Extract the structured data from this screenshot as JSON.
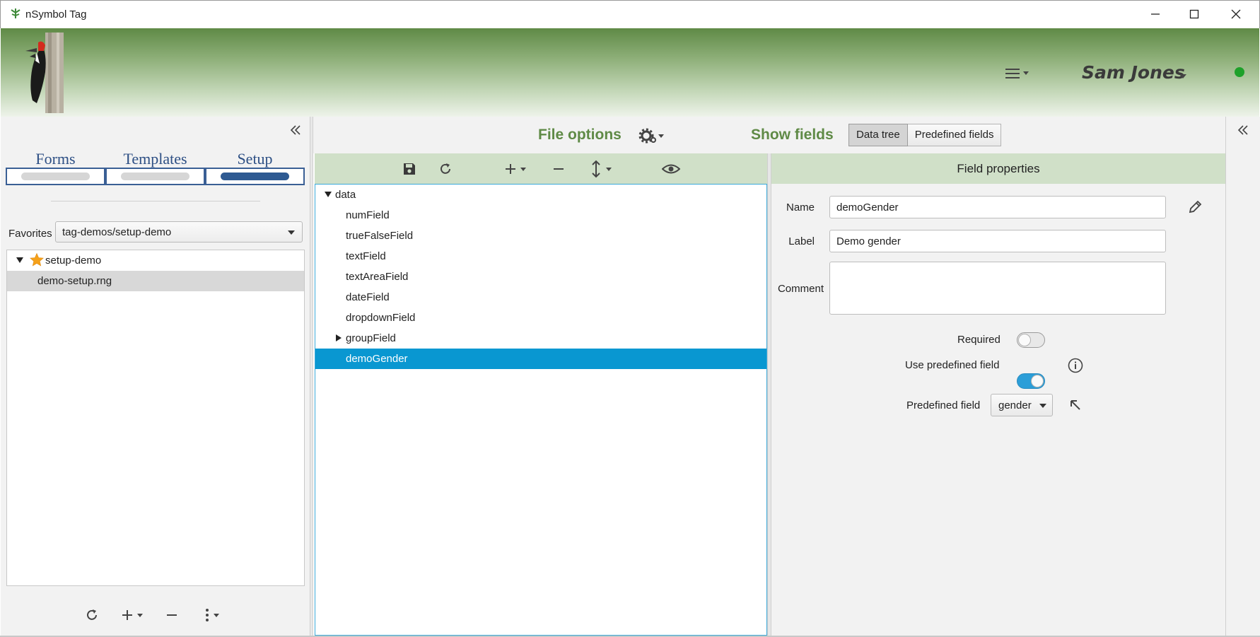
{
  "window": {
    "title": "nSymbol Tag"
  },
  "header": {
    "user_name": "Sam Jones"
  },
  "left": {
    "tabs": [
      {
        "label": "Forms",
        "active": false
      },
      {
        "label": "Templates",
        "active": false
      },
      {
        "label": "Setup",
        "active": true
      }
    ],
    "favorites_label": "Favorites",
    "favorites_value": "tag-demos/setup-demo",
    "tree": [
      {
        "label": "setup-demo",
        "icon": "star-icon",
        "expanded": true
      },
      {
        "label": "demo-setup.rng",
        "selected": true
      }
    ]
  },
  "center": {
    "file_options_label": "File options",
    "show_fields_label": "Show fields",
    "view_buttons": [
      "Data tree",
      "Predefined fields"
    ],
    "active_view": "Data tree",
    "tree": [
      {
        "label": "data",
        "expanded": true,
        "level": 0
      },
      {
        "label": "numField",
        "level": 1
      },
      {
        "label": "trueFalseField",
        "level": 1
      },
      {
        "label": "textField",
        "level": 1
      },
      {
        "label": "textAreaField",
        "level": 1
      },
      {
        "label": "dateField",
        "level": 1
      },
      {
        "label": "dropdownField",
        "level": 1
      },
      {
        "label": "groupField",
        "level": 1,
        "collapsed": true
      },
      {
        "label": "demoGender",
        "level": 1,
        "selected": true
      }
    ]
  },
  "properties": {
    "title": "Field properties",
    "name_label": "Name",
    "name_value": "demoGender",
    "label_label": "Label",
    "label_value": "Demo gender",
    "comment_label": "Comment",
    "comment_value": "",
    "required_label": "Required",
    "required": false,
    "use_predefined_label": "Use predefined field",
    "use_predefined": true,
    "predefined_field_label": "Predefined field",
    "predefined_field_value": "gender"
  },
  "colors": {
    "accent_green": "#5f8a46",
    "selection_blue": "#0997d1",
    "tab_blue": "#2d4f84",
    "status_online": "#1ea12a"
  }
}
